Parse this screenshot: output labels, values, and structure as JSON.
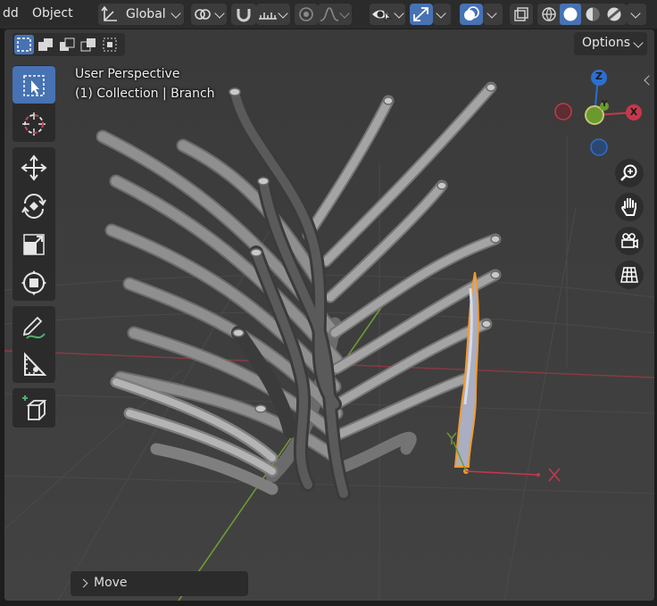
{
  "header": {
    "menu": [
      "dd",
      "Object"
    ],
    "transform_orientation": "Global"
  },
  "viewport": {
    "view_name": "User Perspective",
    "collection_label": "(1) Collection | Branch",
    "options_label": "Options",
    "last_operation": "Move",
    "gizmo_axes": {
      "z": "Z",
      "x": "X",
      "y": "Y"
    },
    "manipulator_axes": {
      "x": "X",
      "y": "Y"
    }
  },
  "toolbar": {
    "tools": [
      "select-box",
      "cursor",
      "move",
      "rotate",
      "scale",
      "transform",
      "annotate",
      "measure",
      "add-cube"
    ]
  },
  "navigation": [
    "zoom-icon",
    "pan-hand-icon",
    "camera-icon",
    "grid-icon"
  ],
  "colors": {
    "accent": "#4772b3",
    "selection_outline": "#f29b2f",
    "axis_x": "#c8374b",
    "axis_y": "#6a9a2e",
    "axis_z": "#2c6fd0"
  }
}
